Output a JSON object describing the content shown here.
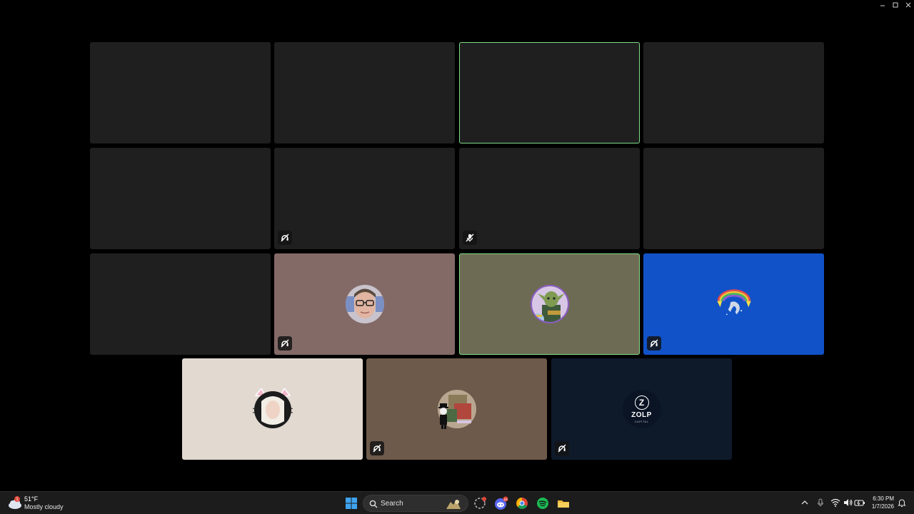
{
  "window": {
    "controls": [
      "minimize",
      "maximize",
      "close"
    ]
  },
  "call": {
    "speaking_color": "#7ddc86",
    "tiles": [
      {
        "row": 1,
        "col": 1,
        "muted": false,
        "speaking": false,
        "bg": "#1f1f1f",
        "avatar": "none"
      },
      {
        "row": 1,
        "col": 2,
        "muted": false,
        "speaking": false,
        "bg": "#1f1f1f",
        "avatar": "none"
      },
      {
        "row": 1,
        "col": 3,
        "muted": false,
        "speaking": true,
        "bg": "#1f1f1f",
        "avatar": "none"
      },
      {
        "row": 1,
        "col": 4,
        "muted": false,
        "speaking": false,
        "bg": "#1f1f1f",
        "avatar": "none"
      },
      {
        "row": 2,
        "col": 1,
        "muted": false,
        "speaking": false,
        "bg": "#1f1f1f",
        "avatar": "none"
      },
      {
        "row": 2,
        "col": 2,
        "muted": true,
        "speaking": false,
        "bg": "#1f1f1f",
        "avatar": "none",
        "badge": "deafened-icon"
      },
      {
        "row": 2,
        "col": 3,
        "muted": true,
        "speaking": false,
        "bg": "#1f1f1f",
        "avatar": "none",
        "badge": "mic-muted-icon"
      },
      {
        "row": 2,
        "col": 4,
        "muted": false,
        "speaking": false,
        "bg": "#1f1f1f",
        "avatar": "none"
      },
      {
        "row": 3,
        "col": 1,
        "muted": false,
        "speaking": false,
        "bg": "#1f1f1f",
        "avatar": "none"
      },
      {
        "row": 3,
        "col": 2,
        "muted": true,
        "speaking": false,
        "bg": "#836a67",
        "avatar": "person-glasses-avatar"
      },
      {
        "row": 3,
        "col": 3,
        "muted": false,
        "speaking": true,
        "bg": "#6e6b55",
        "avatar": "goblin-avatar"
      },
      {
        "row": 3,
        "col": 4,
        "muted": true,
        "speaking": false,
        "bg": "#1152c8",
        "avatar": "dolphin-rainbow-avatar"
      },
      {
        "row": 4,
        "col": 1,
        "muted": false,
        "speaking": false,
        "bg": "#e2d9d1",
        "avatar": "cat-ears-avatar"
      },
      {
        "row": 4,
        "col": 2,
        "muted": true,
        "speaking": false,
        "bg": "#6d5a4b",
        "avatar": "monopoly-avatar"
      },
      {
        "row": 4,
        "col": 3,
        "muted": true,
        "speaking": false,
        "bg": "#0e1a2a",
        "avatar": "zolp-logo-avatar",
        "logo_text": "ZOLP",
        "logo_letter": "Z",
        "logo_sub": "CAPITAL"
      }
    ]
  },
  "taskbar": {
    "weather": {
      "temp": "51°F",
      "desc": "Mostly cloudy",
      "icon": "cloud-icon",
      "badge": "1"
    },
    "start_icon": "windows-start-icon",
    "search": {
      "label": "Search"
    },
    "apps": [
      {
        "name": "copilot-icon",
        "badge": ""
      },
      {
        "name": "discord-icon",
        "badge": "10"
      },
      {
        "name": "chrome-icon",
        "badge": ""
      },
      {
        "name": "spotify-icon",
        "badge": ""
      },
      {
        "name": "file-explorer-icon",
        "badge": ""
      }
    ],
    "tray": {
      "time": "6:30 PM",
      "date": "1/7/2026",
      "icons": [
        "chevron-up-icon",
        "microphone-icon",
        "wifi-icon",
        "volume-icon",
        "battery-icon",
        "bell-icon"
      ]
    }
  }
}
